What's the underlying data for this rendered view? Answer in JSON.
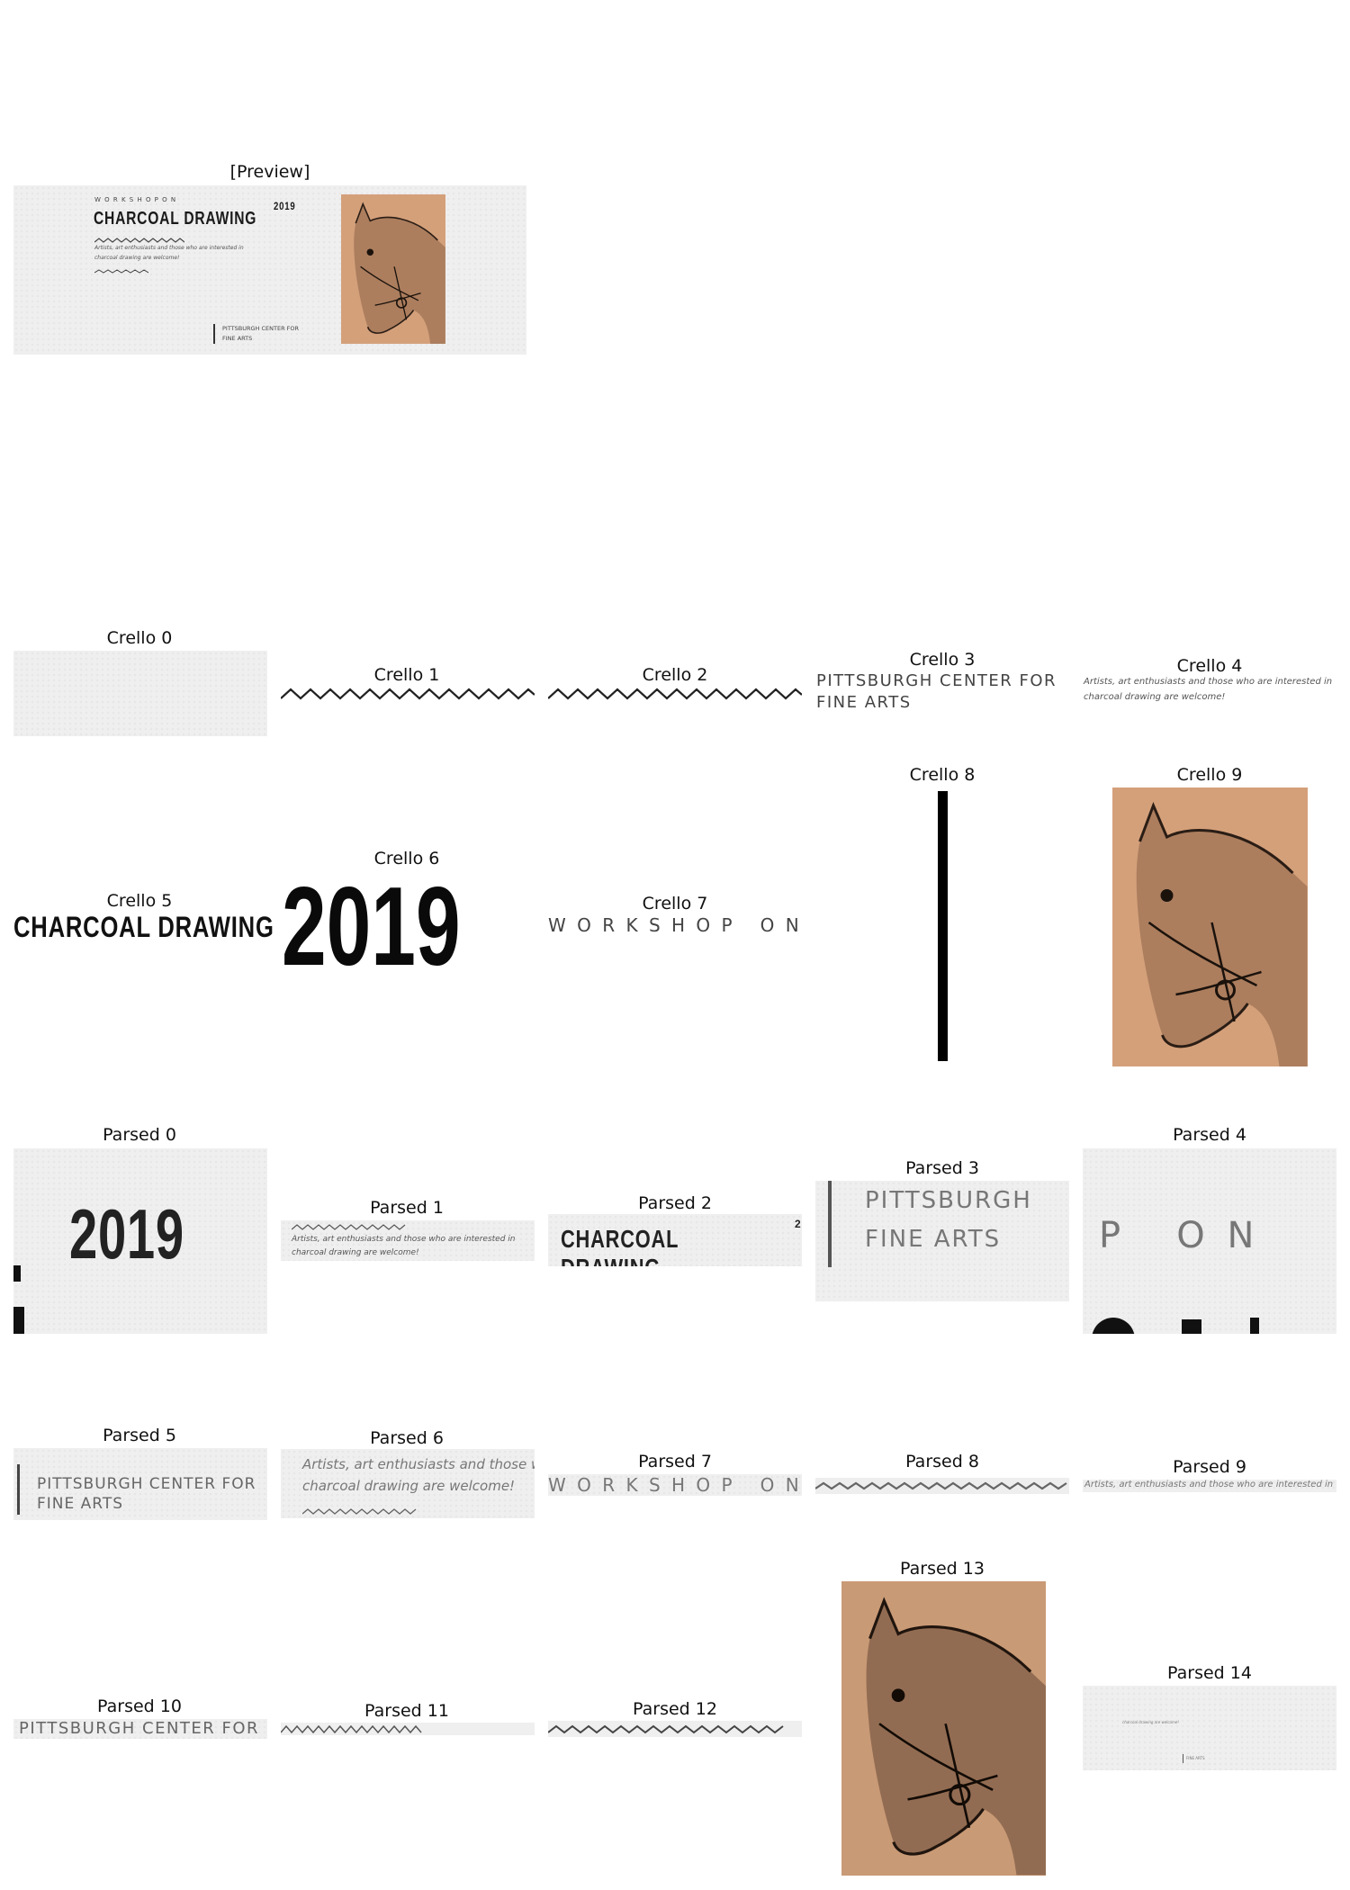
{
  "labels": {
    "preview": "[Preview]",
    "crello": [
      "Crello 0",
      "Crello 1",
      "Crello 2",
      "Crello 3",
      "Crello 4",
      "Crello 5",
      "Crello 6",
      "Crello 7",
      "Crello 8",
      "Crello 9"
    ],
    "parsed": [
      "Parsed 0",
      "Parsed 1",
      "Parsed 2",
      "Parsed 3",
      "Parsed 4",
      "Parsed 5",
      "Parsed 6",
      "Parsed 7",
      "Parsed 8",
      "Parsed 9",
      "Parsed 10",
      "Parsed 11",
      "Parsed 12",
      "Parsed 13",
      "Parsed 14"
    ]
  },
  "design": {
    "kicker": "WORKSHOP ON",
    "kicker_spaced": "W O R K S H O P   O N",
    "title": "CHARCOAL DRAWING",
    "year": "2019",
    "body_line1": "Artists, art enthusiasts and those who are interested in",
    "body_line2": "charcoal drawing are welcome!",
    "venue_line1": "PITTSBURGH CENTER FOR",
    "venue_line2": "FINE ARTS",
    "venue_combined": "PITTSBURGH CENTER FOR FINE ARTS",
    "parsed4_text": "P   O N",
    "parsed6_line1": "Artists, art enthusiasts and those w",
    "parsed14_body": "charcoal drawing are welcome!",
    "parsed14_venue": "FINE ARTS"
  },
  "colors": {
    "paper": "#efefef",
    "ink": "#1a1a1a",
    "text_gray": "#555555",
    "horse_bg": "#d4a07a"
  },
  "icons": {
    "horse": "horse-head-drawing",
    "zigzag": "zigzag-line"
  }
}
